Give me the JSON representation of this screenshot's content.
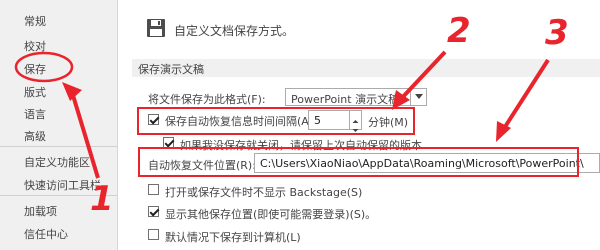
{
  "sidebar": {
    "items": [
      {
        "label": "常规"
      },
      {
        "label": "校对"
      },
      {
        "label": "保存"
      },
      {
        "label": "版式"
      },
      {
        "label": "语言"
      },
      {
        "label": "高级"
      },
      {
        "label": "自定义功能区"
      },
      {
        "label": "快速访问工具栏"
      },
      {
        "label": "加载项"
      },
      {
        "label": "信任中心"
      }
    ]
  },
  "header": {
    "title": "自定义文档保存方式。",
    "icon": "save-disk-icon"
  },
  "section": {
    "title": "保存演示文稿"
  },
  "options": {
    "format_label": "将文件保存为此格式(F):",
    "format_value": "PowerPoint 演示文稿",
    "autorecover_label": "保存自动恢复信息时间间隔(A)",
    "autorecover_checked": true,
    "autorecover_minutes": "5",
    "minutes_unit": "分钟(M)",
    "keep_last_label": "如果我没保存就关闭，请保留上次自动保留的版本",
    "keep_last_checked": true,
    "autorecover_location_label": "自动恢复文件位置(R):",
    "autorecover_location_value": "C:\\Users\\XiaoNiao\\AppData\\Roaming\\Microsoft\\PowerPoint\\",
    "no_backstage_label": "打开或保存文件时不显示 Backstage(S)",
    "no_backstage_checked": false,
    "show_other_locations_label": "显示其他保存位置(即使可能需要登录)(S)。",
    "show_other_locations_checked": true,
    "default_computer_label": "默认情况下保存到计算机(L)",
    "default_computer_checked": false
  },
  "annotations": {
    "step1": "1",
    "step2": "2",
    "step3": "3",
    "color": "#e8242c"
  }
}
